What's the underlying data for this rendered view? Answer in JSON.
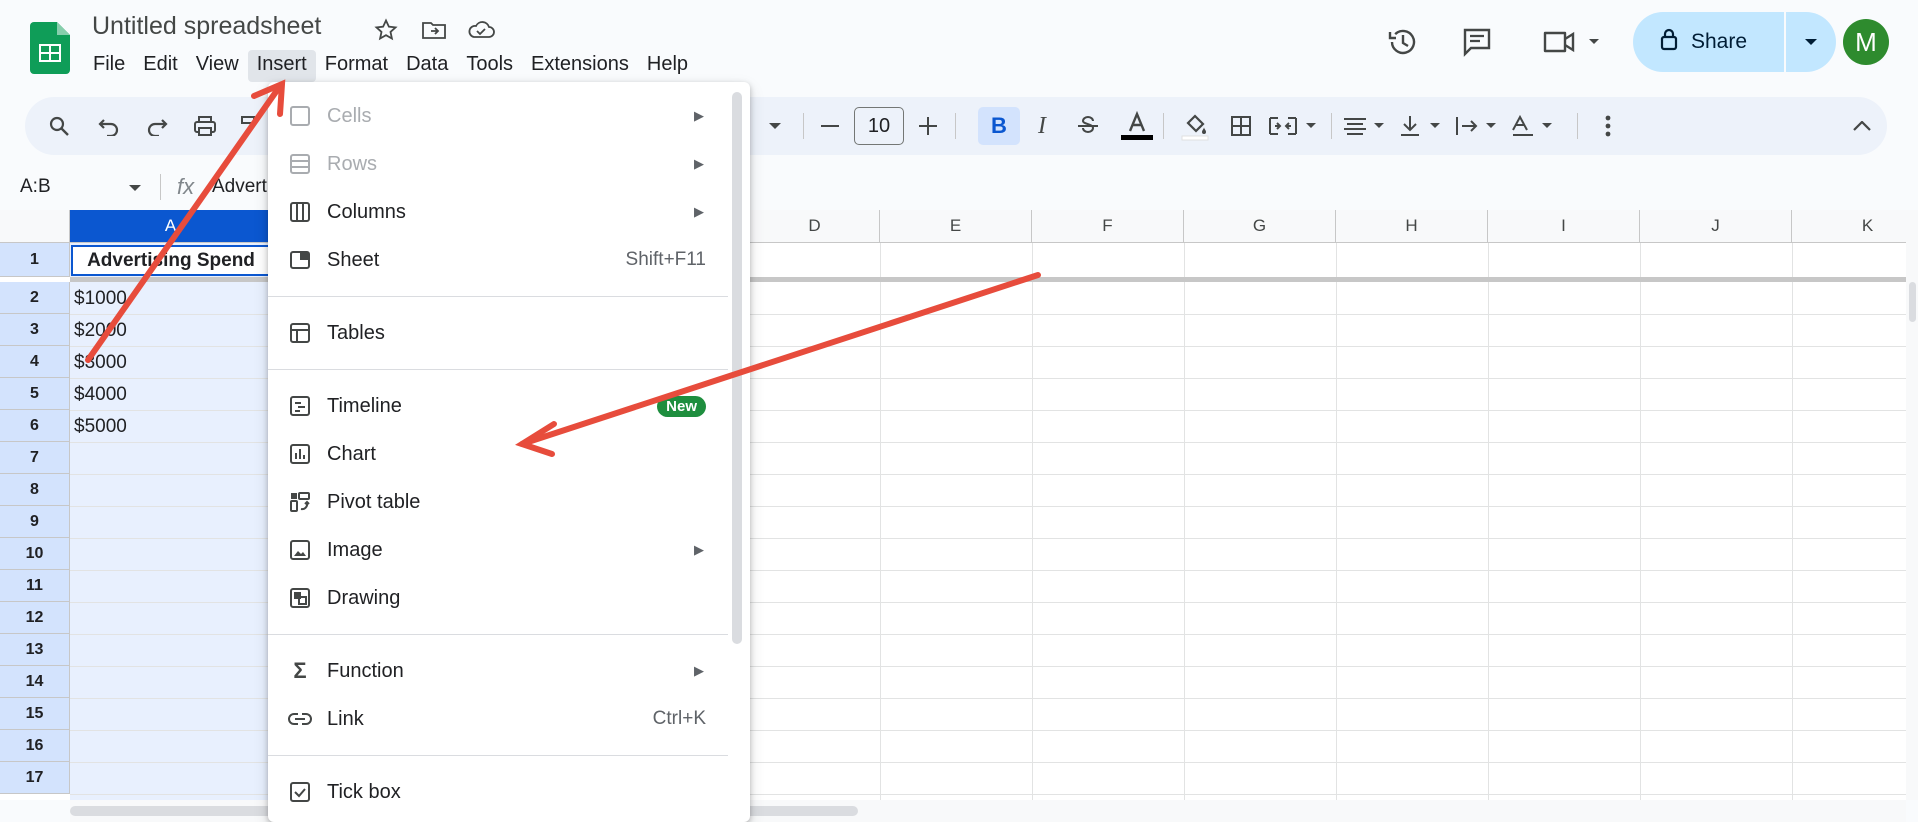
{
  "header": {
    "title": "Untitled spreadsheet",
    "menus": [
      "File",
      "Edit",
      "View",
      "Insert",
      "Format",
      "Data",
      "Tools",
      "Extensions",
      "Help"
    ],
    "active_menu": "Insert",
    "share_label": "Share",
    "avatar_letter": "M"
  },
  "toolbar": {
    "font_size": "10",
    "bold_label": "B",
    "italic_label": "I"
  },
  "formula_bar": {
    "name_box": "A:B",
    "fx": "fx",
    "content": "Advert"
  },
  "grid": {
    "columns": [
      "A",
      "D",
      "E",
      "F",
      "G",
      "H",
      "I",
      "J",
      "K"
    ],
    "rows": [
      "1",
      "2",
      "3",
      "4",
      "5",
      "6",
      "7",
      "8",
      "9",
      "10",
      "11",
      "12",
      "13",
      "14",
      "15",
      "16",
      "17"
    ],
    "cells": {
      "A1": "Advertising Spend",
      "A2": "$1000",
      "A3": "$2000",
      "A4": "$3000",
      "A5": "$4000",
      "A6": "$5000"
    }
  },
  "insert_menu": {
    "items": [
      {
        "label": "Cells",
        "icon": "cells-icon",
        "disabled": true,
        "submenu": true
      },
      {
        "label": "Rows",
        "icon": "rows-icon",
        "disabled": true,
        "submenu": true
      },
      {
        "label": "Columns",
        "icon": "columns-icon",
        "submenu": true
      },
      {
        "label": "Sheet",
        "icon": "sheet-icon",
        "shortcut": "Shift+F11"
      },
      {
        "label": "Tables",
        "icon": "table-icon"
      },
      {
        "label": "Timeline",
        "icon": "timeline-icon",
        "badge": "New"
      },
      {
        "label": "Chart",
        "icon": "chart-icon"
      },
      {
        "label": "Pivot table",
        "icon": "pivot-table-icon"
      },
      {
        "label": "Image",
        "icon": "image-icon",
        "submenu": true
      },
      {
        "label": "Drawing",
        "icon": "drawing-icon"
      },
      {
        "label": "Function",
        "icon": "sigma-icon",
        "submenu": true
      },
      {
        "label": "Link",
        "icon": "link-icon",
        "shortcut": "Ctrl+K"
      },
      {
        "label": "Tick box",
        "icon": "checkbox-icon"
      }
    ]
  },
  "colors": {
    "share_bg": "#c2e7ff",
    "avatar": "#2e8b2e",
    "selection": "#e8f0fe",
    "annotation_arrow": "#e74c3c",
    "new_badge": "#1e8e3e"
  }
}
